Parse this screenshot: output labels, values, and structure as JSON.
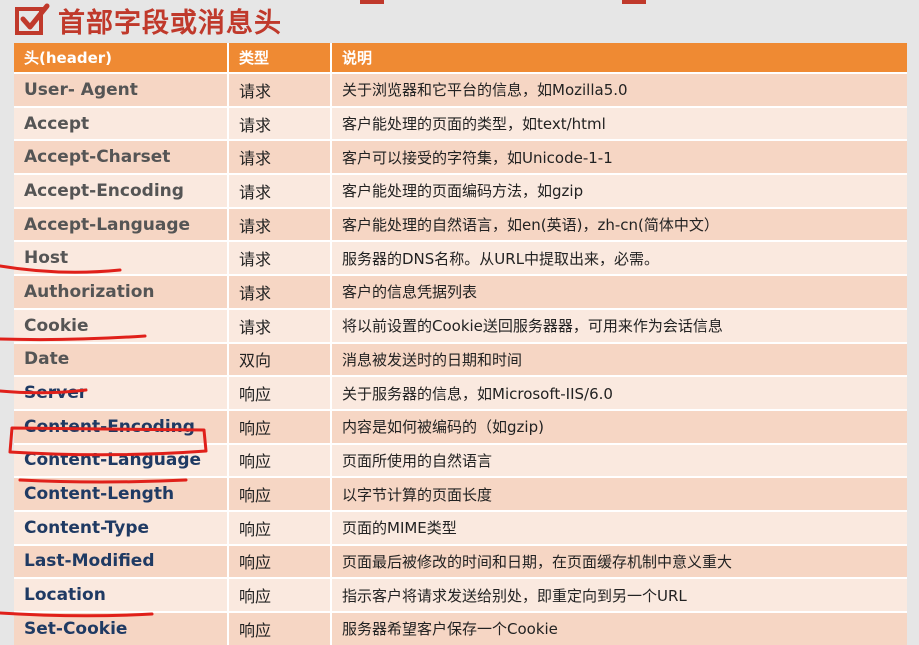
{
  "heading": {
    "title": "首部字段或消息头"
  },
  "table": {
    "columns": [
      "头(header)",
      "类型",
      "说明"
    ],
    "rows": [
      {
        "name": "User- Agent",
        "kind": "请求",
        "desc": "关于浏览器和它平台的信息，如Mozilla5.0"
      },
      {
        "name": "Accept",
        "kind": "请求",
        "desc": "客户能处理的页面的类型，如text/html"
      },
      {
        "name": "Accept-Charset",
        "kind": "请求",
        "desc": "客户可以接受的字符集，如Unicode-1-1"
      },
      {
        "name": "Accept-Encoding",
        "kind": "请求",
        "desc": "客户能处理的页面编码方法，如gzip"
      },
      {
        "name": "Accept-Language",
        "kind": "请求",
        "desc": "客户能处理的自然语言，如en(英语)，zh-cn(简体中文）"
      },
      {
        "name": "Host",
        "kind": "请求",
        "desc": "服务器的DNS名称。从URL中提取出来，必需。"
      },
      {
        "name": "Authorization",
        "kind": "请求",
        "desc": "客户的信息凭据列表"
      },
      {
        "name": "Cookie",
        "kind": "请求",
        "desc": "将以前设置的Cookie送回服务器器，可用来作为会话信息"
      },
      {
        "name": "Date",
        "kind": "双向",
        "desc": "消息被发送时的日期和时间"
      },
      {
        "name": "Server",
        "kind": "响应",
        "desc": "关于服务器的信息，如Microsoft-IIS/6.0"
      },
      {
        "name": "Content-Encoding",
        "kind": "响应",
        "desc": "内容是如何被编码的（如gzip)"
      },
      {
        "name": "Content-Language",
        "kind": "响应",
        "desc": "页面所使用的自然语言"
      },
      {
        "name": "Content-Length",
        "kind": "响应",
        "desc": "以字节计算的页面长度"
      },
      {
        "name": "Content-Type",
        "kind": "响应",
        "desc": "页面的MIME类型"
      },
      {
        "name": "Last-Modified",
        "kind": "响应",
        "desc": "页面最后被修改的时间和日期，在页面缓存机制中意义重大"
      },
      {
        "name": "Location",
        "kind": "响应",
        "desc": "指示客户将请求发送给别处，即重定向到另一个URL"
      },
      {
        "name": "Set-Cookie",
        "kind": "响应",
        "desc": "服务器希望客户保存一个Cookie"
      }
    ]
  },
  "colors": {
    "title": "#c0392b",
    "header_bg": "#ef8a33",
    "row_odd": "#f6d6c4",
    "row_even": "#fae9df",
    "annotation": "#e0201a"
  },
  "icons": {
    "title_icon": "checkbox-check-icon"
  }
}
